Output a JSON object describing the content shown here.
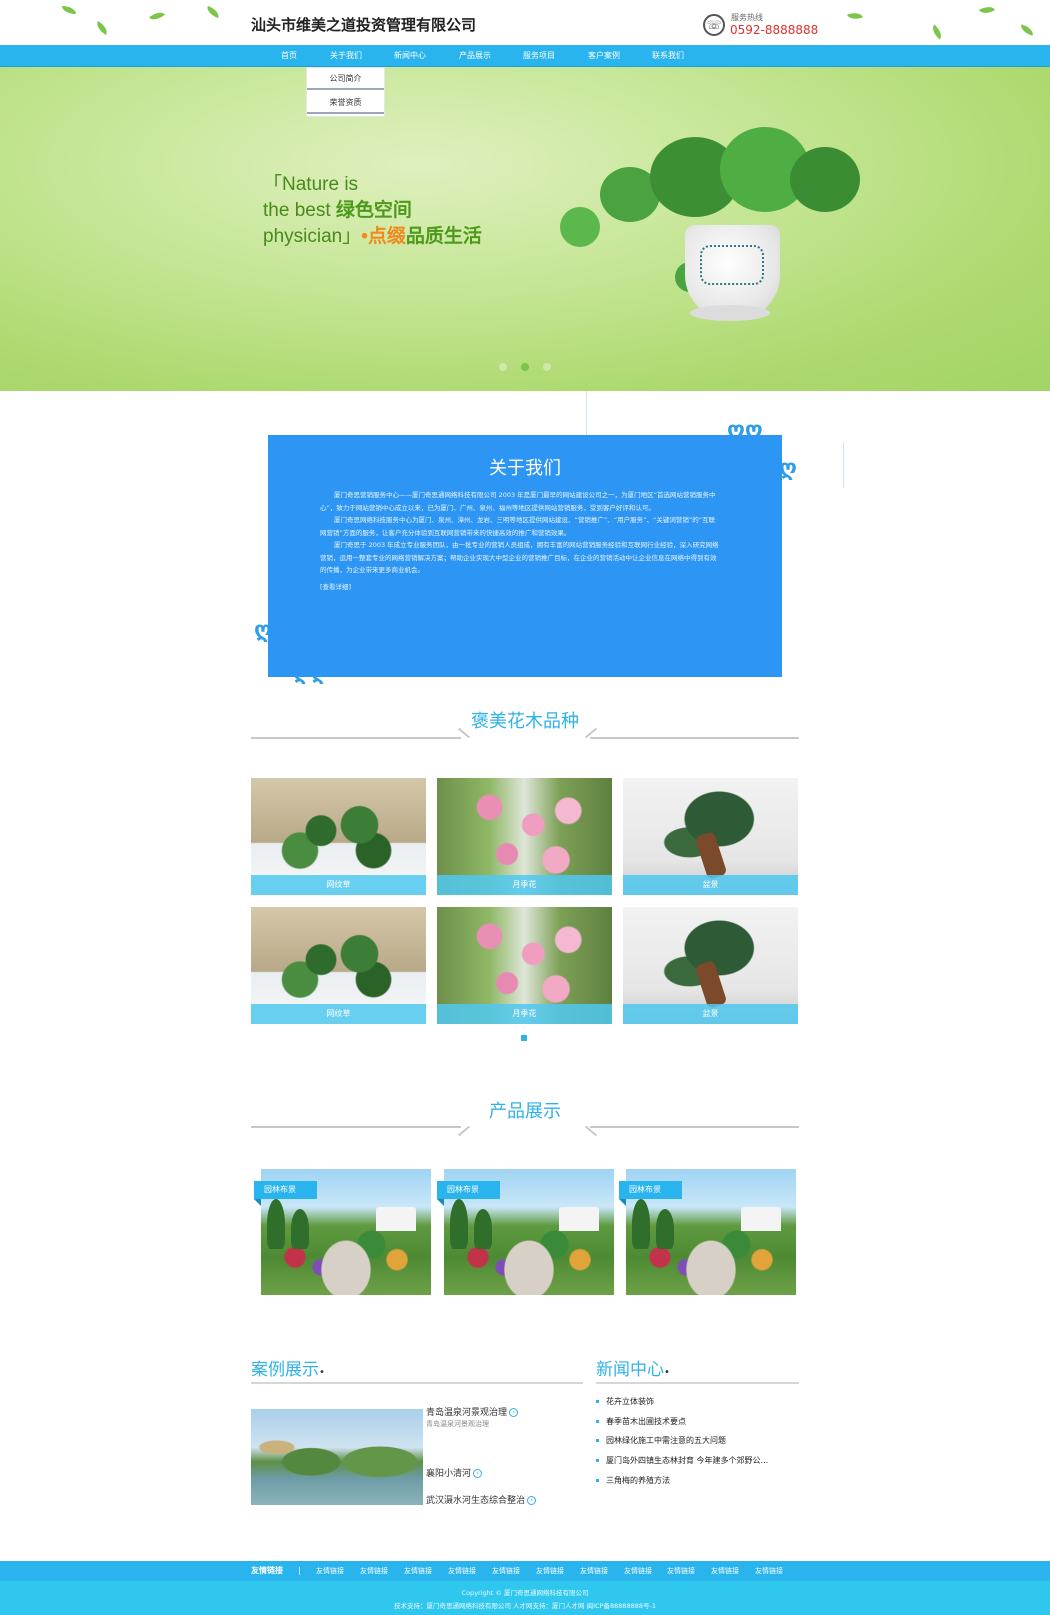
{
  "header": {
    "company_name": "汕头市维美之道投资管理有限公司",
    "hotline_label": "服务热线",
    "hotline_number": "0592-8888888"
  },
  "nav": {
    "items": [
      "首页",
      "关于我们",
      "新闻中心",
      "产品展示",
      "服务项目",
      "客户案例",
      "联系我们"
    ],
    "dropdown": [
      "公司简介",
      "荣誉资质"
    ]
  },
  "banner": {
    "line1": "Nature is",
    "line2_en": "the best ",
    "line2_cn": "绿色空间",
    "line3_en": "physician",
    "line3_dot": "•",
    "line3_cn_orange": "点缀",
    "line3_cn_green": "品质生活"
  },
  "about": {
    "title": "关于我们",
    "paragraphs": [
      "厦门奇思营销服务中心——厦门奇思通网络科技有限公司 2003 年是厦门最早的网站建设公司之一，为厦门地区“首选网站营销服务中心”，致力于网站营销中心成立以来，已为厦门、广州、泉州、福州等地区提供网站营销服务，受到客户好评和认可。",
      "厦门奇思网络科技服务中心为厦门、泉州、漳州、龙岩、三明等地区提供网站建设、“营销推广”、“用户服务”、“关键词营销”的“互联网营销”方面的服务，让客户充分体验到互联网营销带来的快捷高效的推广和营销效果。",
      "厦门奇思于 2003 年成立专业服务团队，由一批专业的营销人员组成，拥有丰富的网站营销服务经验和互联网行业经验，深入研究网络营销，运用一整套专业的网络营销解决方案；帮助企业实现大中型企业的营销推广目标，在企业的营销活动中让企业信息在网络中得到有效的传播，为企业带来更多商业机会。"
    ],
    "more": "[查看详细]"
  },
  "flowers": {
    "title": "褒美花木品种",
    "items": [
      {
        "label": "网纹草",
        "kind": "fittonia"
      },
      {
        "label": "月季花",
        "kind": "rose"
      },
      {
        "label": "盆景",
        "kind": "bonsai"
      },
      {
        "label": "网纹草",
        "kind": "fittonia"
      },
      {
        "label": "月季花",
        "kind": "rose"
      },
      {
        "label": "盆景",
        "kind": "bonsai"
      }
    ]
  },
  "products": {
    "title": "产品展示",
    "items": [
      {
        "tag": "园林布景"
      },
      {
        "tag": "园林布景"
      },
      {
        "tag": "园林布景"
      }
    ]
  },
  "cases": {
    "title": "案例展示",
    "bullet": "•",
    "items": [
      {
        "name": "青岛温泉河景观治理",
        "sub": "青岛温泉河景观治理"
      },
      {
        "name": "襄阳小清河",
        "sub": ""
      },
      {
        "name": "武汉滠水河生态综合整治",
        "sub": ""
      }
    ]
  },
  "news": {
    "title": "新闻中心",
    "bullet": "•",
    "items": [
      "花卉立体装饰",
      "春季苗木出圃技术要点",
      "园林绿化施工中需注意的五大问题",
      "厦门岛外四镇生态林封育 今年建多个郊野公...",
      "三角梅的养殖方法"
    ]
  },
  "footer": {
    "links_title": "友情链接",
    "separator": "|",
    "links": [
      "友情链接",
      "友情链接",
      "友情链接",
      "友情链接",
      "友情链接",
      "友情链接",
      "友情链接",
      "友情链接",
      "友情链接",
      "友情链接",
      "友情链接",
      "友情链接"
    ],
    "copyright": "Copyright © 厦门奇思通网络科技有限公司",
    "support": "技术支持：厦门奇思通网络科技有限公司 人才网支持：厦门人才网 闽ICP备88888888号-1"
  },
  "colors": {
    "primary": "#29b4ee",
    "about_bg": "#2d96f5",
    "banner_green": "#add96e",
    "hotline_red": "#e03030"
  }
}
